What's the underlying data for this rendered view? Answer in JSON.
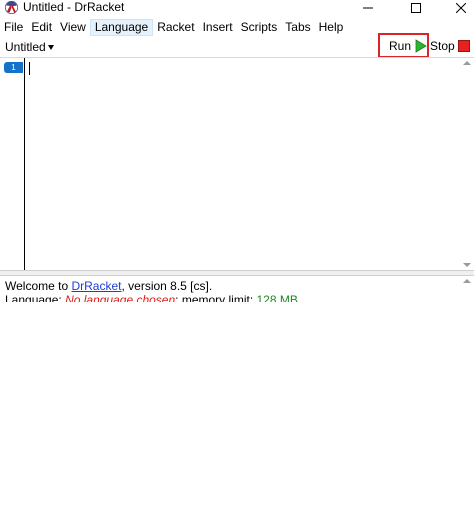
{
  "window": {
    "title": "Untitled - DrRacket",
    "controls": {
      "minimize": "minimize-icon",
      "maximize": "maximize-icon",
      "close": "close-icon"
    }
  },
  "menu": {
    "items": [
      "File",
      "Edit",
      "View",
      "Language",
      "Racket",
      "Insert",
      "Scripts",
      "Tabs",
      "Help"
    ],
    "active": "Language"
  },
  "toolbar": {
    "doc_name": "Untitled",
    "run_label": "Run",
    "stop_label": "Stop",
    "colors": {
      "run_highlight": "#d9242a",
      "run_icon": "#2db52d",
      "stop_icon": "#e8201f"
    }
  },
  "editor": {
    "line_number": "1",
    "content": ""
  },
  "interactions": {
    "welcome_prefix": "Welcome to ",
    "welcome_link": "DrRacket",
    "welcome_suffix": ", version 8.5 [cs].",
    "language_label": "Language: ",
    "language_value": "No language chosen",
    "memory_label": "; memory limit: ",
    "memory_value": "128 MB"
  }
}
